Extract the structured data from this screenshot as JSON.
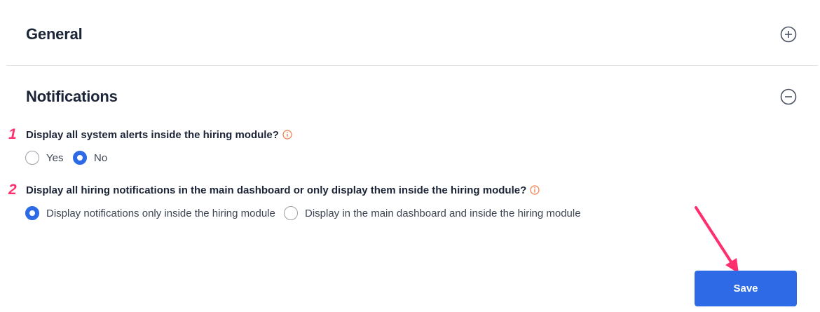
{
  "sections": {
    "general": {
      "title": "General",
      "toggle_icon": "plus-circle-icon"
    },
    "notifications": {
      "title": "Notifications",
      "toggle_icon": "minus-circle-icon"
    }
  },
  "questions": [
    {
      "number": "1",
      "text": "Display all system alerts inside the hiring module?",
      "info_icon": "info-icon",
      "options": [
        {
          "label": "Yes",
          "selected": false
        },
        {
          "label": "No",
          "selected": true
        }
      ]
    },
    {
      "number": "2",
      "text": "Display all hiring notifications in the main dashboard or only display them inside the hiring module?",
      "info_icon": "info-icon",
      "options": [
        {
          "label": "Display notifications only inside the hiring module",
          "selected": true
        },
        {
          "label": "Display in the main dashboard and inside the hiring module",
          "selected": false
        }
      ]
    }
  ],
  "save_button": {
    "label": "Save"
  },
  "colors": {
    "accent": "#2e6ae6",
    "annotation": "#ff2f6d",
    "info": "#f07a45",
    "title": "#1c2537",
    "divider": "#dfe2e7"
  }
}
